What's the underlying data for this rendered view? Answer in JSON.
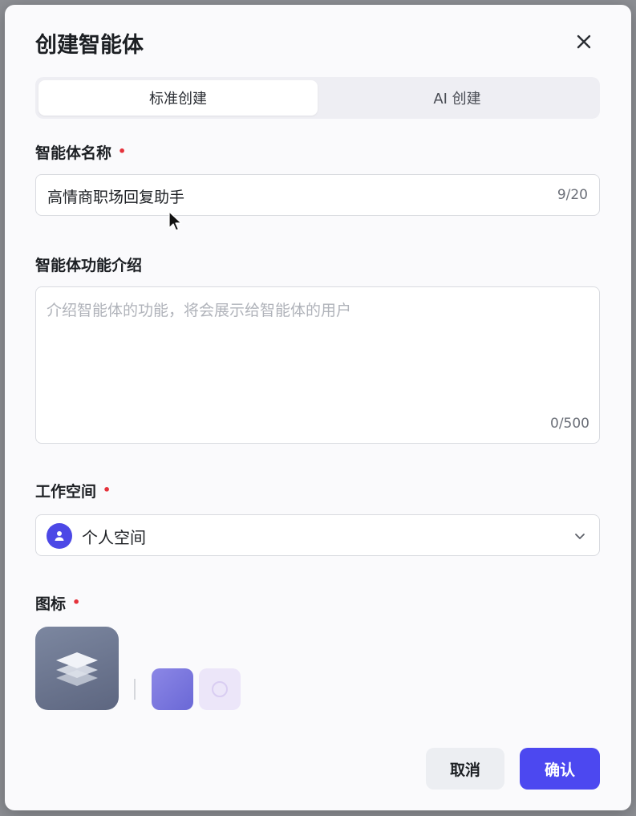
{
  "dialog": {
    "title": "创建智能体",
    "tabs": [
      {
        "label": "标准创建",
        "active": true
      },
      {
        "label": "AI 创建",
        "active": false
      }
    ]
  },
  "form": {
    "name": {
      "label": "智能体名称",
      "required_mark": "•",
      "value": "高情商职场回复助手",
      "counter": "9/20"
    },
    "description": {
      "label": "智能体功能介绍",
      "placeholder": "介绍智能体的功能，将会展示给智能体的用户",
      "counter": "0/500"
    },
    "workspace": {
      "label": "工作空间",
      "required_mark": "•",
      "selected": "个人空间",
      "avatar_icon": "user-icon"
    },
    "icon": {
      "label": "图标",
      "required_mark": "•",
      "main_icon": "layers-icon",
      "swatches": [
        "#7c78e0",
        "#ece6f9"
      ]
    }
  },
  "footer": {
    "cancel_label": "取消",
    "confirm_label": "确认"
  },
  "colors": {
    "accent": "#4c48f0",
    "required": "#e5323b"
  }
}
